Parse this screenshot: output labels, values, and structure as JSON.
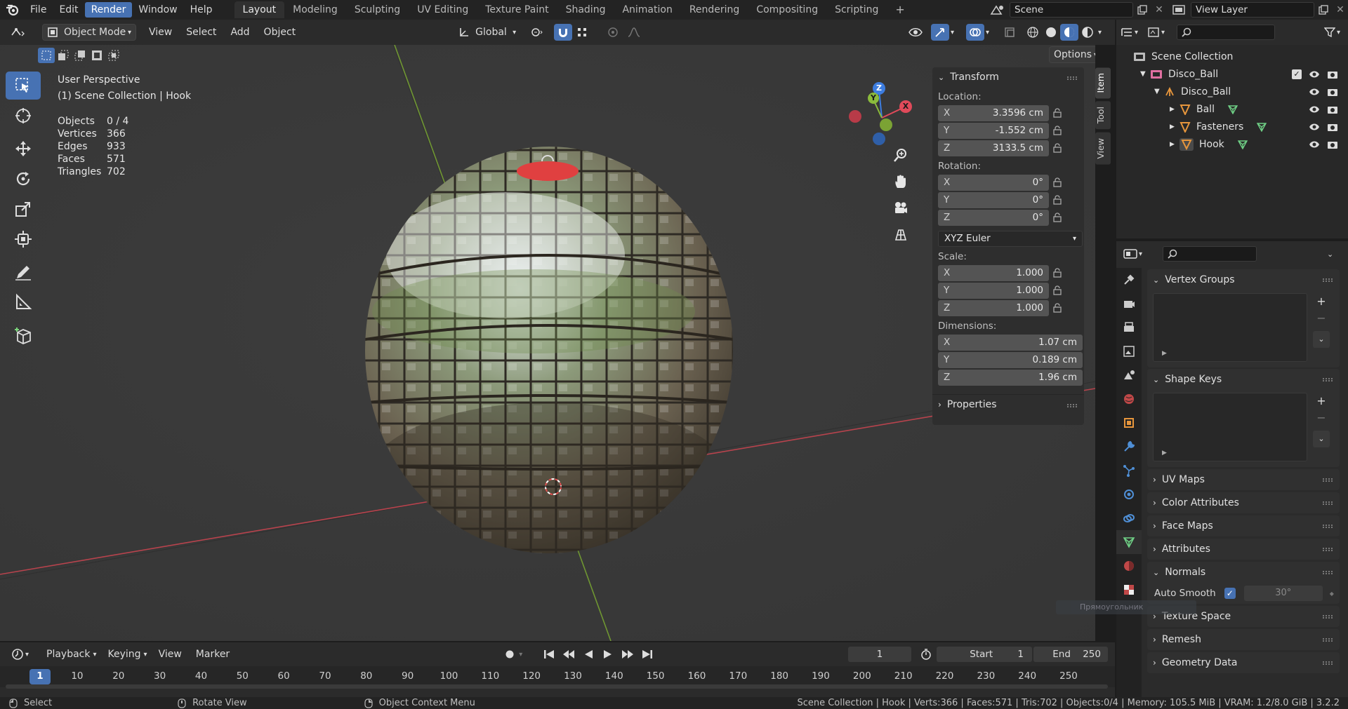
{
  "topbar": {
    "menus": [
      "File",
      "Edit",
      "Render",
      "Window",
      "Help"
    ],
    "active_menu": "Render",
    "workspaces": [
      "Layout",
      "Modeling",
      "Sculpting",
      "UV Editing",
      "Texture Paint",
      "Shading",
      "Animation",
      "Rendering",
      "Compositing",
      "Scripting"
    ],
    "active_workspace": "Layout",
    "add_tab": "+",
    "scene_name": "Scene",
    "view_layer": "View Layer"
  },
  "viewport_header": {
    "mode": "Object Mode",
    "menus": [
      "View",
      "Select",
      "Add",
      "Object"
    ],
    "orientation": "Global",
    "options_label": "Options"
  },
  "overlay": {
    "perspective": "User Perspective",
    "context": "(1) Scene Collection | Hook",
    "stats": [
      {
        "label": "Objects",
        "value": "0 / 4"
      },
      {
        "label": "Vertices",
        "value": "366"
      },
      {
        "label": "Edges",
        "value": "933"
      },
      {
        "label": "Faces",
        "value": "571"
      },
      {
        "label": "Triangles",
        "value": "702"
      }
    ],
    "gizmo": {
      "x": "X",
      "y": "Y",
      "z": "Z"
    }
  },
  "npanel": {
    "tabs": [
      "Item",
      "Tool",
      "View"
    ],
    "active_tab": "Item",
    "transform_title": "Transform",
    "location_label": "Location:",
    "location": [
      {
        "axis": "X",
        "value": "3.3596 cm"
      },
      {
        "axis": "Y",
        "value": "-1.552 cm"
      },
      {
        "axis": "Z",
        "value": "3133.5 cm"
      }
    ],
    "rotation_label": "Rotation:",
    "rotation": [
      {
        "axis": "X",
        "value": "0°"
      },
      {
        "axis": "Y",
        "value": "0°"
      },
      {
        "axis": "Z",
        "value": "0°"
      }
    ],
    "rotation_mode": "XYZ Euler",
    "scale_label": "Scale:",
    "scale": [
      {
        "axis": "X",
        "value": "1.000"
      },
      {
        "axis": "Y",
        "value": "1.000"
      },
      {
        "axis": "Z",
        "value": "1.000"
      }
    ],
    "dimensions_label": "Dimensions:",
    "dimensions": [
      {
        "axis": "X",
        "value": "1.07 cm"
      },
      {
        "axis": "Y",
        "value": "0.189 cm"
      },
      {
        "axis": "Z",
        "value": "1.96 cm"
      }
    ],
    "properties_title": "Properties"
  },
  "outliner": {
    "root": "Scene Collection",
    "collection": "Disco_Ball",
    "empty": "Disco_Ball",
    "children": [
      "Ball",
      "Fasteners",
      "Hook"
    ]
  },
  "properties": {
    "vertex_groups": "Vertex Groups",
    "shape_keys": "Shape Keys",
    "collapsed": [
      "UV Maps",
      "Color Attributes",
      "Face Maps",
      "Attributes"
    ],
    "normals": "Normals",
    "auto_smooth_label": "Auto Smooth",
    "auto_smooth_angle": "30°",
    "tooltip": "Прямоугольник",
    "after": [
      "Texture Space",
      "Remesh",
      "Geometry Data"
    ]
  },
  "timeline": {
    "menus": [
      "Playback",
      "Keying",
      "View",
      "Marker"
    ],
    "current_frame": "1",
    "start_label": "Start",
    "start": "1",
    "end_label": "End",
    "end": "250",
    "ticks": [
      "1",
      "10",
      "20",
      "30",
      "40",
      "50",
      "60",
      "70",
      "80",
      "90",
      "100",
      "110",
      "120",
      "130",
      "140",
      "150",
      "160",
      "170",
      "180",
      "190",
      "200",
      "210",
      "220",
      "230",
      "240",
      "250"
    ]
  },
  "statusbar": {
    "select": "Select",
    "rotate": "Rotate View",
    "context": "Object Context Menu",
    "info": "Scene Collection | Hook | Verts:366 | Faces:571 | Tris:702 | Objects:0/4 | Memory: 105.5 MiB | VRAM: 1.2/8.0 GiB | 3.2.2"
  },
  "colors": {
    "accent": "#4772b3",
    "x_axis": "#e04a5a",
    "y_axis": "#8bbb3c",
    "z_axis": "#3d7de0",
    "mesh_icon": "#e7963c",
    "vertex_green": "#6fcf85"
  }
}
